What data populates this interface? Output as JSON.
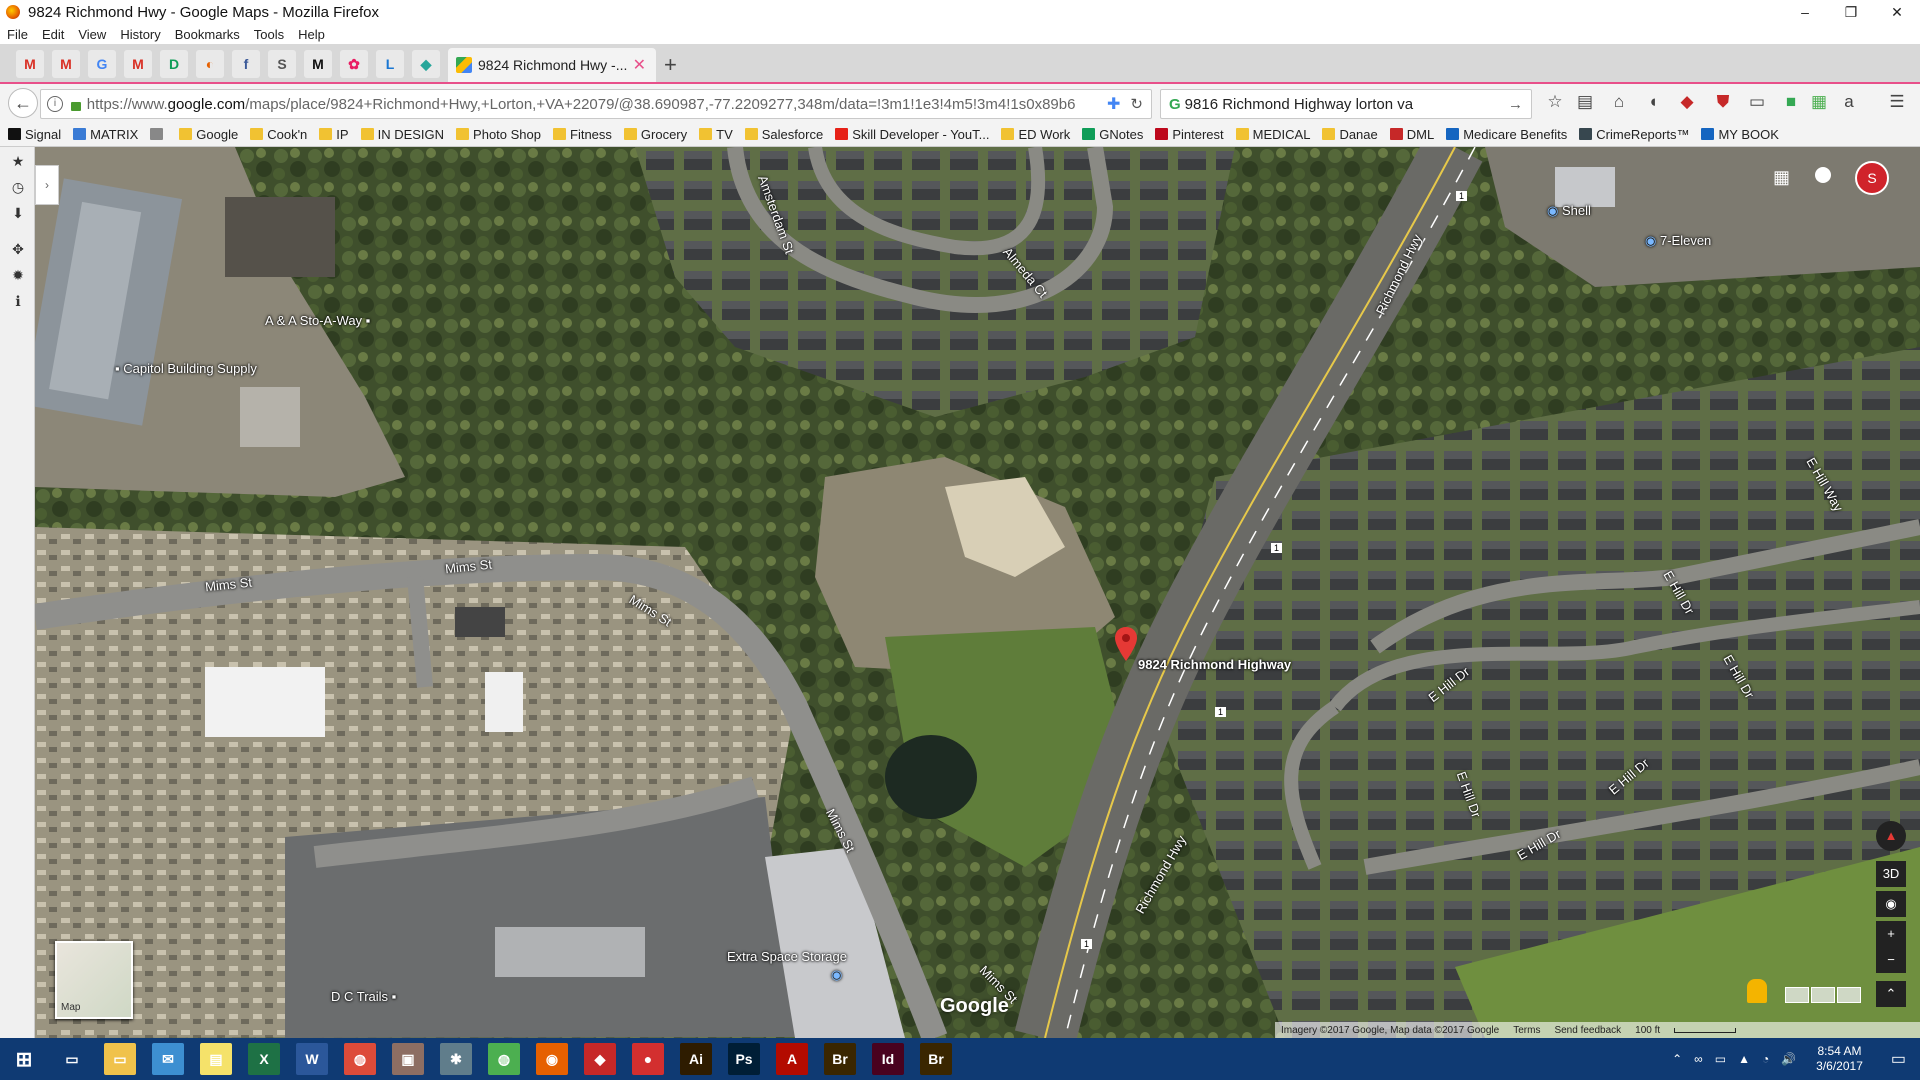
{
  "window": {
    "title": "9824 Richmond Hwy - Google Maps - Mozilla Firefox",
    "controls": [
      "–",
      "❐",
      "✕"
    ]
  },
  "menu": [
    "File",
    "Edit",
    "View",
    "History",
    "Bookmarks",
    "Tools",
    "Help"
  ],
  "tabs": {
    "pinned": [
      "M",
      "M",
      "G",
      "M",
      "D",
      "◐",
      "f",
      "S",
      "M",
      "✿",
      "L",
      "◆"
    ],
    "active": {
      "label": "9824 Richmond Hwy -...",
      "close": "✕"
    },
    "new_tab": "+"
  },
  "nav": {
    "url_prefix": "https://www.",
    "url_domain": "google.com",
    "url_rest": "/maps/place/9824+Richmond+Hwy,+Lorton,+VA+22079/@38.690987,-77.2209277,348m/data=!3m1!1e3!4m5!3m4!1s0x89b6",
    "search_value": "9816 Richmond Highway lorton va"
  },
  "bookmarks": [
    {
      "label": "Signal",
      "color": "#111111"
    },
    {
      "label": "MATRIX",
      "color": "#3a7bd5"
    },
    {
      "label": "",
      "color": "#888888"
    },
    {
      "label": "Google",
      "color": "folder"
    },
    {
      "label": "Cook'n",
      "color": "folder"
    },
    {
      "label": "IP",
      "color": "folder"
    },
    {
      "label": "IN DESIGN",
      "color": "folder"
    },
    {
      "label": "Photo Shop",
      "color": "folder"
    },
    {
      "label": "Fitness",
      "color": "folder"
    },
    {
      "label": "Grocery",
      "color": "folder"
    },
    {
      "label": "TV",
      "color": "folder"
    },
    {
      "label": "Salesforce",
      "color": "folder"
    },
    {
      "label": "Skill Developer - YouT...",
      "color": "#e62117"
    },
    {
      "label": "ED Work",
      "color": "folder"
    },
    {
      "label": "GNotes",
      "color": "#0f9d58"
    },
    {
      "label": "Pinterest",
      "color": "#bd081c"
    },
    {
      "label": "MEDICAL",
      "color": "folder"
    },
    {
      "label": "Danae",
      "color": "folder"
    },
    {
      "label": "DML",
      "color": "#c62828"
    },
    {
      "label": "Medicare Benefits",
      "color": "#1565c0"
    },
    {
      "label": "CrimeReports™",
      "color": "#37474f"
    },
    {
      "label": "MY BOOK",
      "color": "#1565c0"
    }
  ],
  "map": {
    "pin_label": "9824 Richmond Highway",
    "places": [
      {
        "key": "shell",
        "label": "Shell"
      },
      {
        "key": "seven",
        "label": "7-Eleven"
      },
      {
        "key": "sto",
        "label": "A & A Sto-A-Way"
      },
      {
        "key": "capitol",
        "label": "Capitol Building Supply"
      },
      {
        "key": "extra",
        "label": "Extra Space Storage"
      },
      {
        "key": "dc",
        "label": "D C Trails"
      }
    ],
    "streets": {
      "mims1": "Mims St",
      "mims2": "Mims St",
      "mims3": "Mims St",
      "mims4": "Mims St",
      "mims5": "Mims St",
      "amsterdam": "Amsterdam St",
      "almeda": "Almeda Ct",
      "richmond1": "Richmond Hwy",
      "richmond2": "Richmond Hwy",
      "ehill1": "E Hill Dr",
      "ehill2": "E Hill Dr",
      "ehill3": "E Hill Dr",
      "ehill4": "E Hill Dr",
      "ehill5": "E Hill Dr",
      "ehill6": "E Hill Dr",
      "ehill7": "E Hill Way"
    },
    "route_shields": [
      "1",
      "1",
      "1",
      "1"
    ],
    "minimap_label": "Map",
    "google_logo": "Google",
    "controls": {
      "compass": "▲",
      "view3d": "3D",
      "locate": "◉",
      "zoom_in": "+",
      "zoom_out": "−",
      "expand": "⌃"
    },
    "footer": {
      "imagery": "Imagery ©2017 Google, Map data ©2017 Google",
      "terms": "Terms",
      "feedback": "Send feedback",
      "scale": "100 ft"
    },
    "avatar_initial": "S"
  },
  "taskbar": {
    "apps": [
      {
        "name": "file-explorer",
        "glyph": "▭",
        "color": "#f0c24b"
      },
      {
        "name": "mail",
        "glyph": "✉",
        "color": "#3d8fd1"
      },
      {
        "name": "sticky-notes",
        "glyph": "▤",
        "color": "#f5e26a"
      },
      {
        "name": "excel",
        "glyph": "X",
        "color": "#1e7145"
      },
      {
        "name": "word",
        "glyph": "W",
        "color": "#2b579a"
      },
      {
        "name": "chrome-alt",
        "glyph": "◍",
        "color": "#dd4b39"
      },
      {
        "name": "archive",
        "glyph": "▣",
        "color": "#8d6e63"
      },
      {
        "name": "app",
        "glyph": "✱",
        "color": "#607d8b"
      },
      {
        "name": "chrome",
        "glyph": "◍",
        "color": "#4caf50"
      },
      {
        "name": "firefox",
        "glyph": "◉",
        "color": "#e66000"
      },
      {
        "name": "app-red",
        "glyph": "◆",
        "color": "#c62828"
      },
      {
        "name": "app-red2",
        "glyph": "●",
        "color": "#d32f2f"
      },
      {
        "name": "illustrator",
        "glyph": "Ai",
        "color": "#2e1c00"
      },
      {
        "name": "photoshop",
        "glyph": "Ps",
        "color": "#001e36"
      },
      {
        "name": "acrobat",
        "glyph": "A",
        "color": "#b30b00"
      },
      {
        "name": "bridge",
        "glyph": "Br",
        "color": "#3a2600"
      },
      {
        "name": "indesign",
        "glyph": "Id",
        "color": "#49021f"
      },
      {
        "name": "bridge2",
        "glyph": "Br",
        "color": "#3a2600"
      }
    ],
    "time": "8:54 AM",
    "date": "3/6/2017"
  }
}
